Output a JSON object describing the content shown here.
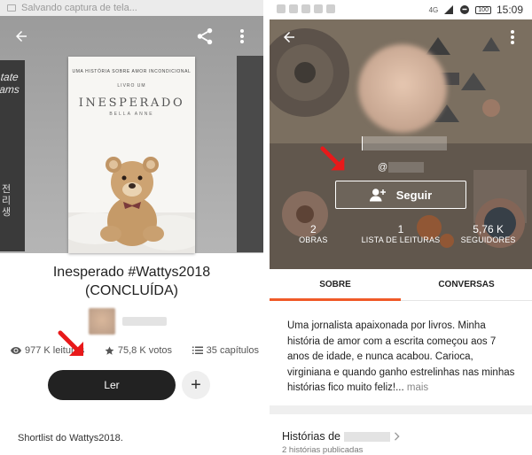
{
  "left": {
    "status_text": "Salvando captura de tela...",
    "cover": {
      "tagline": "UMA HISTÓRIA SOBRE AMOR INCONDICIONAL",
      "subtitle": "LIVRO UM",
      "title": "INESPERADO",
      "author": "BELLA ANNE"
    },
    "side_book_text": "tate\nams",
    "side_book_korean": "전\n리\n생",
    "title_line1": "Inesperado #Wattys2018",
    "title_line2": "(CONCLUÍDA)",
    "stats": {
      "reads": "977 K leituras",
      "votes": "75,8 K votos",
      "chapters": "35 capítulos"
    },
    "read_button": "Ler",
    "add_button": "+",
    "description": "Shortlist do Wattys2018."
  },
  "right": {
    "time": "15:09",
    "network": "4G",
    "battery": "100",
    "handle_prefix": "@",
    "follow_button": "Seguir",
    "counts": [
      {
        "num": "2",
        "label": "OBRAS"
      },
      {
        "num": "1",
        "label": "LISTA DE LEITURAS"
      },
      {
        "num": "5,76 K",
        "label": "SEGUIDORES"
      }
    ],
    "tabs": [
      "SOBRE",
      "CONVERSAS"
    ],
    "bio": "Uma jornalista apaixonada por livros. Minha história de amor com a escrita começou aos 7 anos de idade, e nunca acabou. Carioca, virginiana e quando ganho estrelinhas nas minhas histórias fico muito feliz!...",
    "bio_more": "mais",
    "stories_title": "Histórias de",
    "stories_count": "2 histórias publicadas"
  },
  "colors": {
    "accent": "#f05a28",
    "annotation_arrow": "#e8191a",
    "button_dark": "#222222"
  }
}
